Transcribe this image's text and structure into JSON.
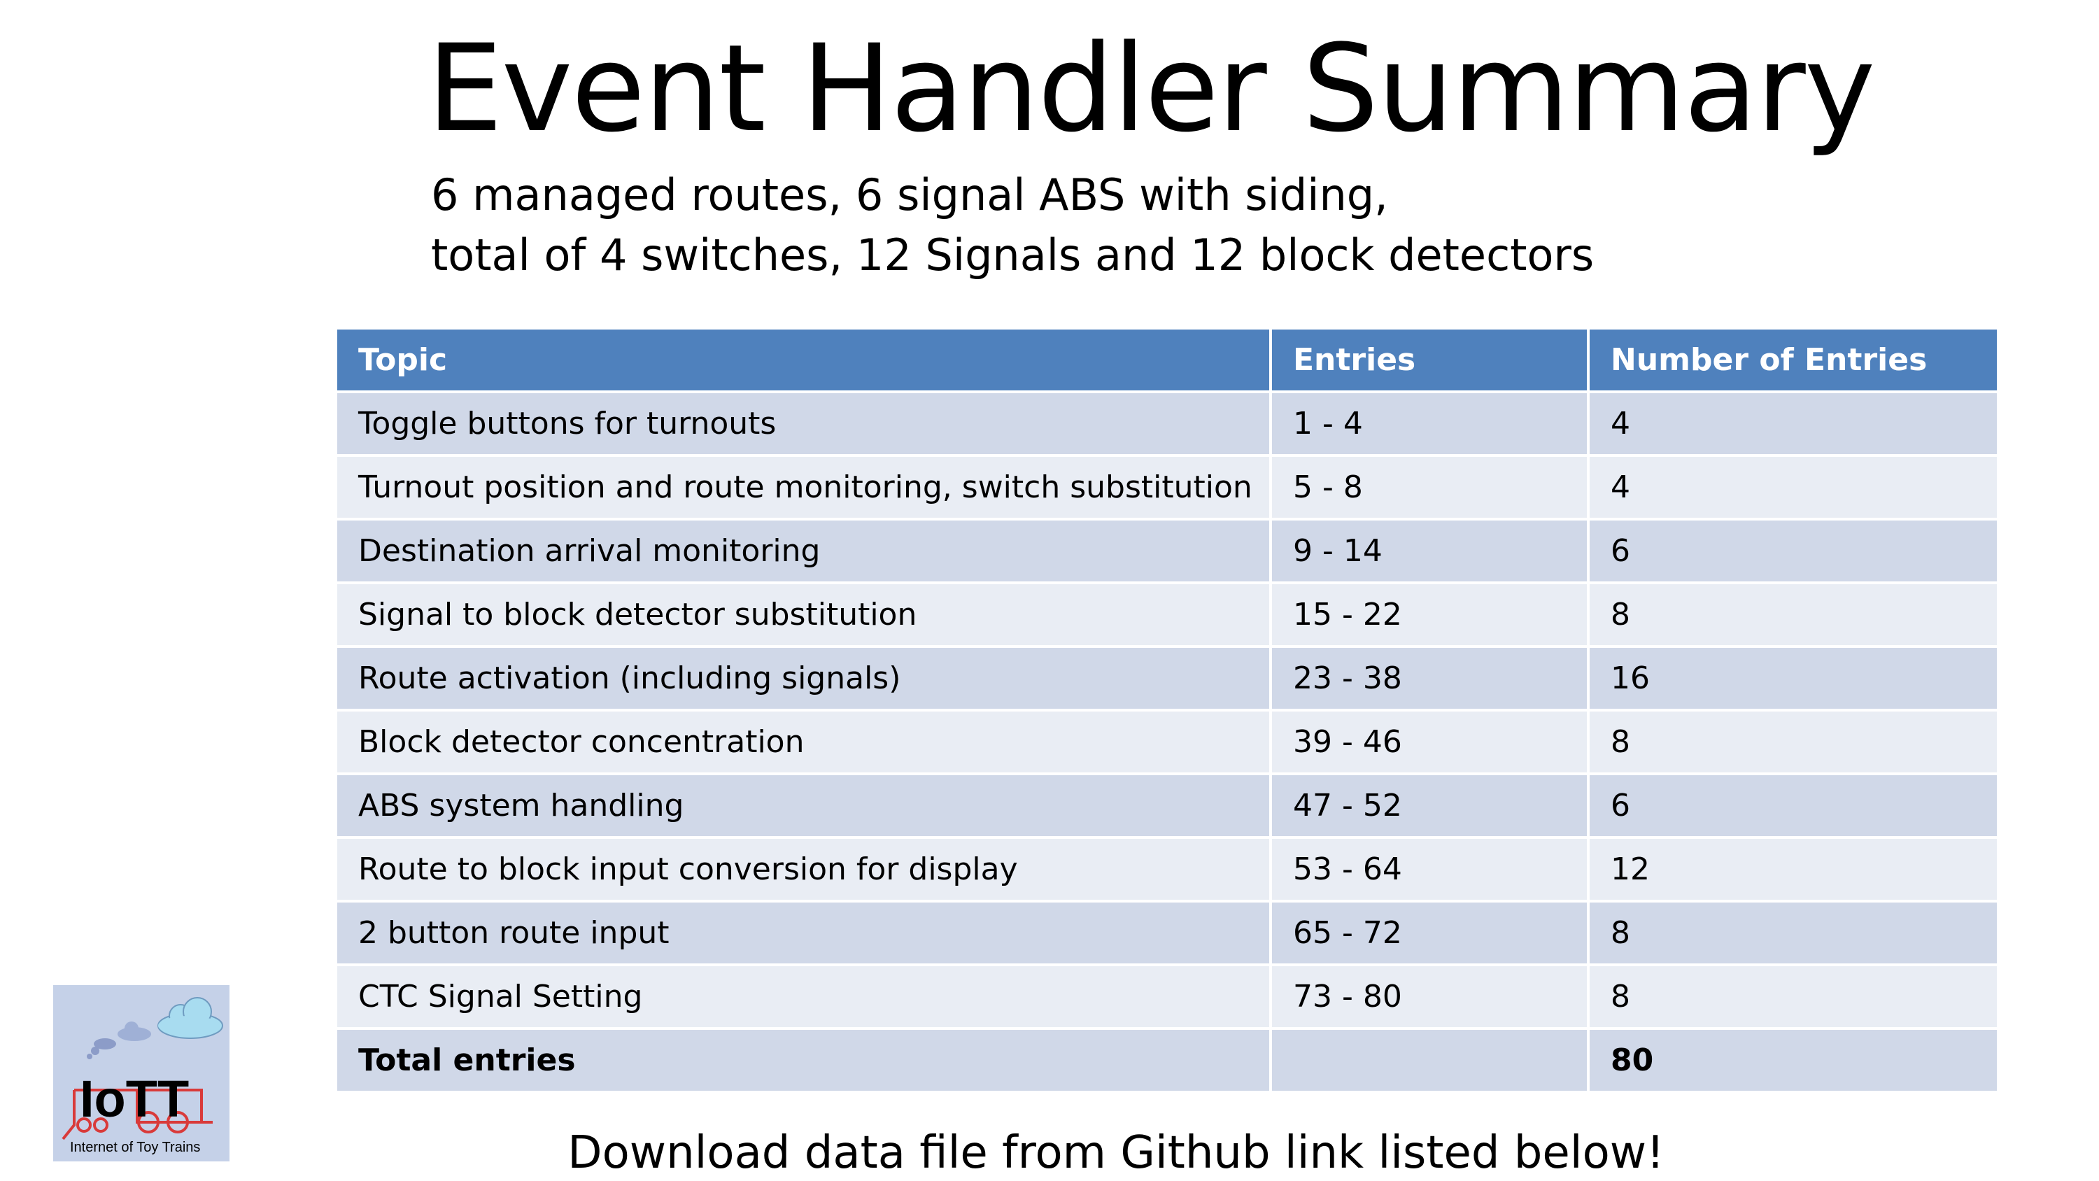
{
  "title": "Event Handler Summary",
  "subtitle": {
    "line1": "6 managed routes, 6 signal ABS with siding,",
    "line2": "total of 4 switches, 12 Signals and 12 block detectors"
  },
  "table": {
    "headers": {
      "topic": "Topic",
      "entries": "Entries",
      "count": "Number of Entries"
    },
    "rows": [
      {
        "topic": "Toggle  buttons for turnouts",
        "entries": "1 - 4",
        "count": "4"
      },
      {
        "topic": "Turnout position and route monitoring, switch substitution",
        "entries": "5 - 8",
        "count": "4"
      },
      {
        "topic": "Destination arrival monitoring",
        "entries": "9 - 14",
        "count": "6"
      },
      {
        "topic": "Signal to block detector substitution",
        "entries": "15 - 22",
        "count": "8"
      },
      {
        "topic": "Route activation (including signals)",
        "entries": "23 - 38",
        "count": "16"
      },
      {
        "topic": "Block detector concentration",
        "entries": "39 - 46",
        "count": "8"
      },
      {
        "topic": "ABS system handling",
        "entries": "47 - 52",
        "count": "6"
      },
      {
        "topic": "Route to block input conversion for display",
        "entries": "53 - 64",
        "count": "12"
      },
      {
        "topic": "2 button route input",
        "entries": "65 - 72",
        "count": "8"
      },
      {
        "topic": "CTC Signal Setting",
        "entries": "73 - 80",
        "count": "8"
      }
    ],
    "total": {
      "topic": "Total entries",
      "entries": "",
      "count": "80"
    }
  },
  "footer": "Download data file from Github link listed below!",
  "logo": {
    "text": "IoTT",
    "caption": "Internet of Toy Trains",
    "colors": {
      "background": "#c5d1e8",
      "cloud": "#a8dcf0",
      "train": "#d93a3a"
    }
  },
  "colors": {
    "header_bg": "#4f81bd",
    "row_odd": "#d0d8e8",
    "row_even": "#e9edf4"
  }
}
